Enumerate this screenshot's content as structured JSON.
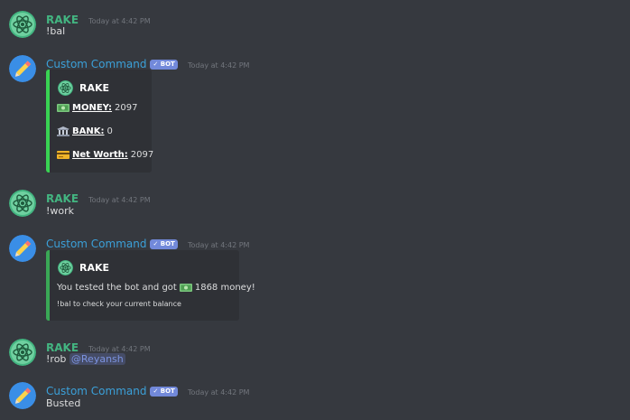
{
  "messages": [
    {
      "username": "RAKE",
      "timestamp": "Today at 4:42 PM",
      "text": "!bal"
    },
    {
      "username": "Custom Command",
      "badge": "✓ BOT",
      "timestamp": "Today at 4:42 PM",
      "embed": {
        "author": "RAKE",
        "fields": [
          {
            "icon": "money-icon",
            "label": "MONEY:",
            "value": "2097"
          },
          {
            "icon": "bank-icon",
            "label": "BANK:",
            "value": "0"
          },
          {
            "icon": "credit-card-icon",
            "label": "Net Worth:",
            "value": "2097"
          }
        ],
        "color": "#39d353"
      }
    },
    {
      "username": "RAKE",
      "timestamp": "Today at 4:42 PM",
      "text": "!work"
    },
    {
      "username": "Custom Command",
      "badge": "✓ BOT",
      "timestamp": "Today at 4:42 PM",
      "embed": {
        "author": "RAKE",
        "line1_a": "You tested the bot and got",
        "line1_b": "1868 money!",
        "line2": "!bal to check your current balance",
        "color": "#3aa856"
      }
    },
    {
      "username": "RAKE",
      "timestamp": "Today at 4:42 PM",
      "text": "!rob",
      "mention": "@Reyansh"
    },
    {
      "username": "Custom Command",
      "badge": "✓ BOT",
      "timestamp": "Today at 4:42 PM",
      "text": "Busted"
    }
  ],
  "colors": {
    "background": "#36393f",
    "embed_bg": "#2f3136",
    "user_green": "#43b581",
    "bot_blue": "#3ba0d9",
    "badge": "#7289da"
  }
}
